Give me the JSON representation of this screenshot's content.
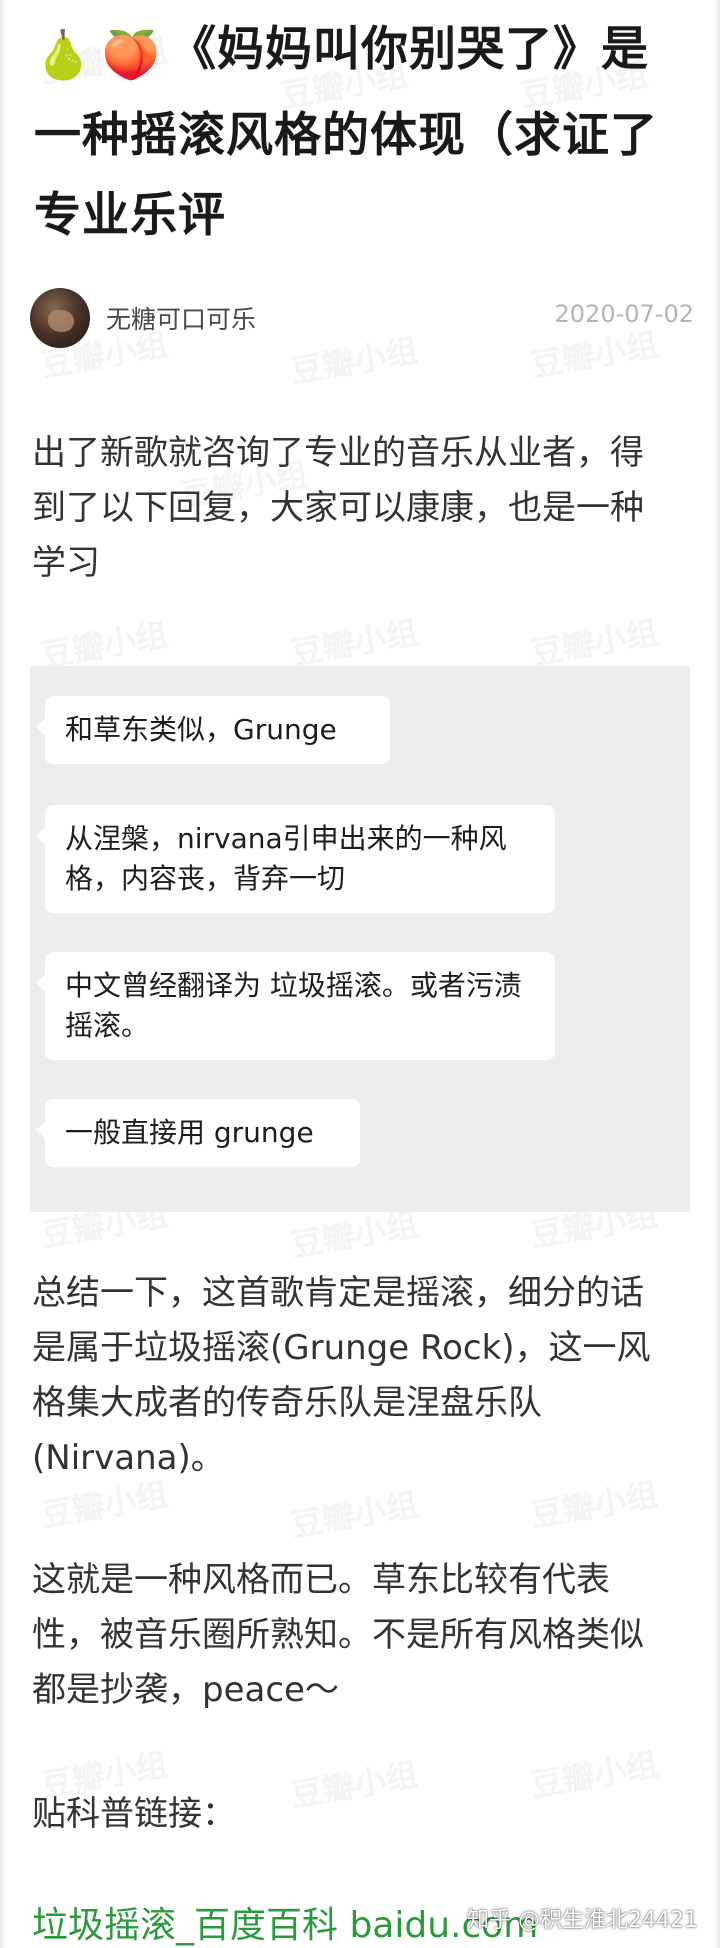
{
  "post": {
    "title_emoji": [
      "🍐",
      "🍑"
    ],
    "title": "《妈妈叫你别哭了》是一种摇滚风格的体现（求证了专业乐评",
    "author": "无糖可口可乐",
    "date": "2020-07-02",
    "intro": "出了新歌就咨询了专业的音乐从业者，得到了以下回复，大家可以康康，也是一种学习",
    "chat_messages": [
      "和草东类似，Grunge",
      "从涅槃，nirvana引申出来的一种风格，内容丧，背弃一切",
      "中文曾经翻译为 垃圾摇滚。或者污渍摇滚。",
      "一般直接用 grunge"
    ],
    "summary": "总结一下，这首歌肯定是摇滚，细分的话是属于垃圾摇滚(Grunge Rock)，这一风格集大成者的传奇乐队是涅盘乐队(Nirvana)。",
    "style_note": "这就是一种风格而已。草东比较有代表性，被音乐圈所熟知。不是所有风格类似都是抄袭，peace～",
    "link_label": "贴科普链接：",
    "link_text": "垃圾摇滚_百度百科 baidu.com"
  },
  "watermark": "豆瓣小组",
  "overlay": {
    "zhihu_credit": "知乎 @积生淮北24421"
  },
  "colors": {
    "link": "#2a9a3c",
    "chat_background": "#ededed",
    "date": "#b4b4b4"
  }
}
